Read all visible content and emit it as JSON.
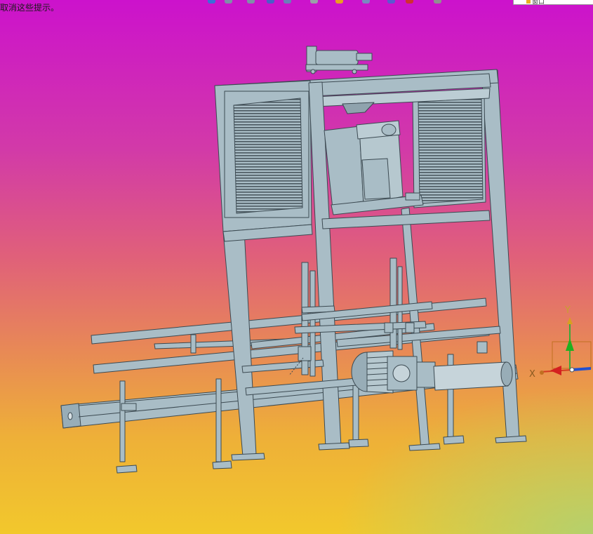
{
  "status": {
    "hint_text": "取消这些提示。"
  },
  "toolbar": {
    "icons": [
      {
        "name": "view-orientation-icon",
        "color": "#3a6fd8"
      },
      {
        "name": "zoom-fit-icon",
        "color": "#7f8fa8"
      },
      {
        "name": "zoom-area-icon",
        "color": "#7f8fa8"
      },
      {
        "name": "rotate-view-icon",
        "color": "#4a5ec8"
      },
      {
        "name": "section-view-icon",
        "color": "#6a7fb8"
      },
      {
        "name": "display-style-icon",
        "color": "#9aa0a8"
      },
      {
        "name": "hide-show-icon",
        "color": "#e8a020"
      },
      {
        "name": "edit-appearance-icon",
        "color": "#7a88c0"
      },
      {
        "name": "apply-scene-icon",
        "color": "#5a5ad0"
      },
      {
        "name": "view-settings-icon",
        "color": "#d03030"
      },
      {
        "name": "camera-icon",
        "color": "#909090"
      }
    ]
  },
  "view_selector": {
    "label": "窗口"
  },
  "triad": {
    "x_label": "X",
    "y_label": "Y",
    "x_color": "#d42020",
    "y_color": "#20b020",
    "z_color": "#2050d0"
  },
  "model": {
    "fill": "#a9bdc6",
    "stroke": "#3c4a52"
  }
}
